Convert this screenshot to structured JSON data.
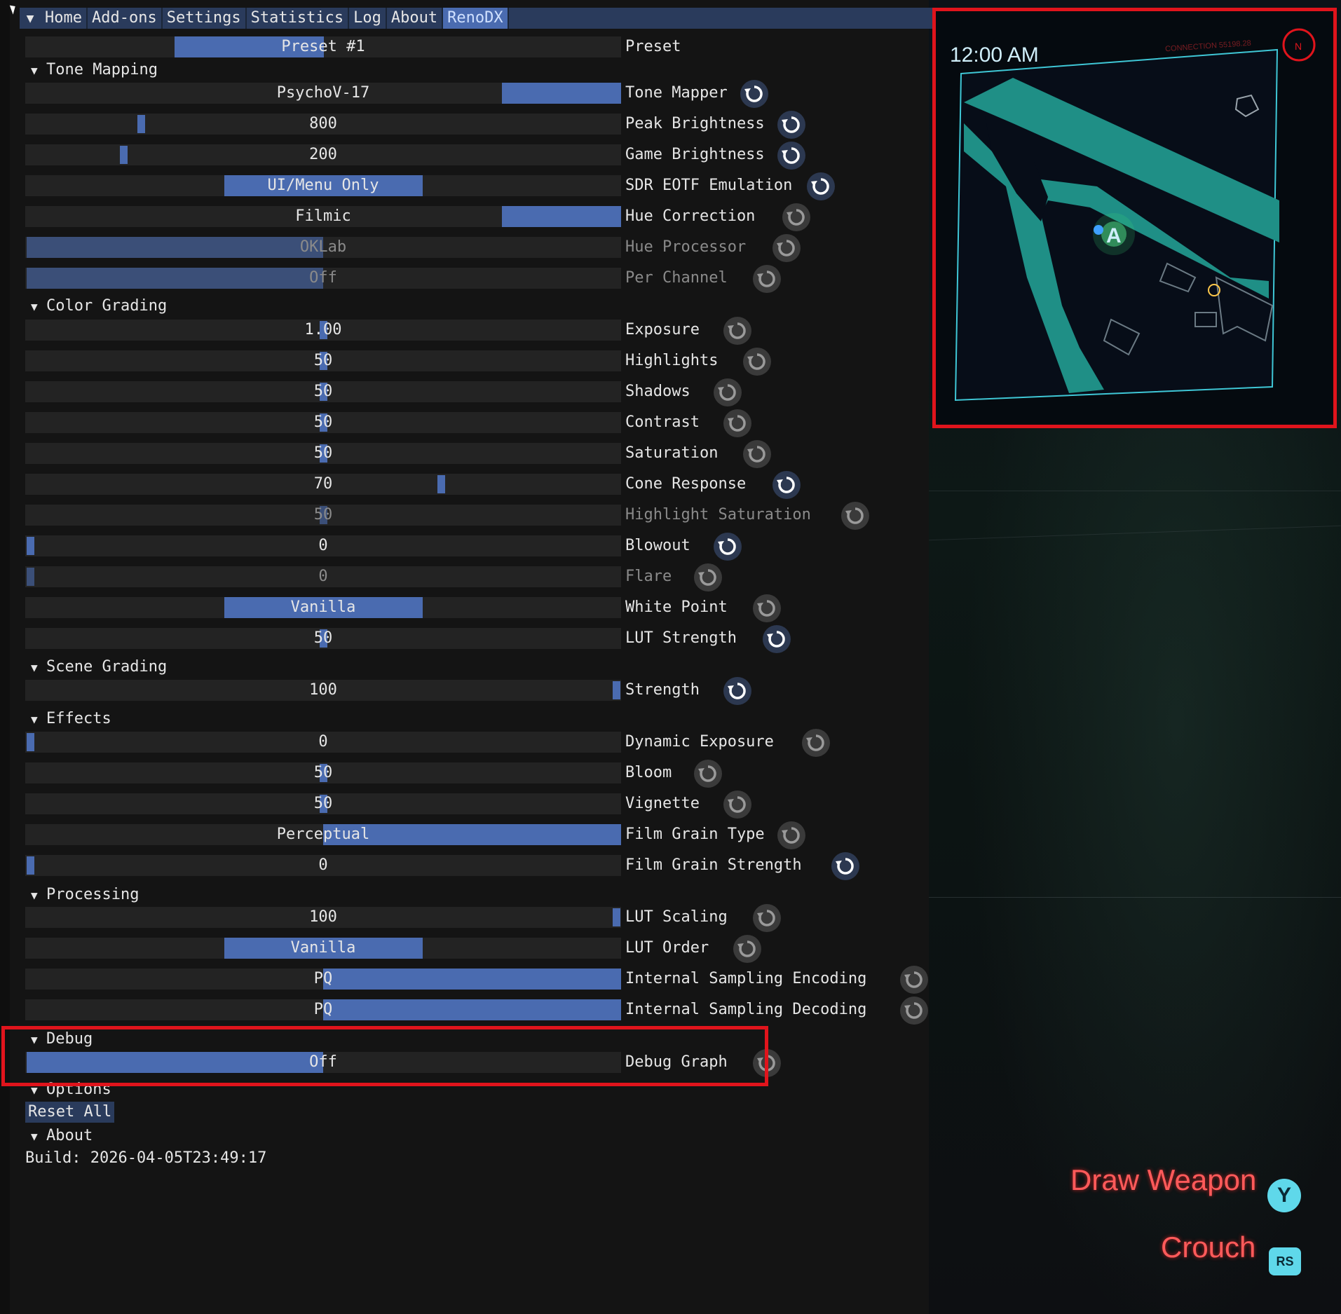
{
  "menu": {
    "items": [
      "Home",
      "Add-ons",
      "Settings",
      "Statistics",
      "Log",
      "About",
      "RenoDX"
    ],
    "active": "RenoDX"
  },
  "preset": {
    "value": "Preset #1",
    "label": "Preset"
  },
  "sections": {
    "tone_mapping": "Tone Mapping",
    "color_grading": "Color Grading",
    "scene_grading": "Scene Grading",
    "effects": "Effects",
    "processing": "Processing",
    "debug": "Debug",
    "options": "Options",
    "about": "About"
  },
  "settings": {
    "tone_mapper": {
      "value": "PsychoV-17",
      "label": "Tone Mapper"
    },
    "peak_brightness": {
      "value": "800",
      "label": "Peak Brightness"
    },
    "game_brightness": {
      "value": "200",
      "label": "Game Brightness"
    },
    "sdr_eotf": {
      "value": "UI/Menu Only",
      "label": "SDR EOTF Emulation"
    },
    "hue_correction": {
      "value": "Filmic",
      "label": "Hue Correction"
    },
    "hue_processor": {
      "value": "OKLab",
      "label": "Hue Processor"
    },
    "per_channel": {
      "value": "Off",
      "label": "Per Channel"
    },
    "exposure": {
      "value": "1.00",
      "label": "Exposure"
    },
    "highlights": {
      "value": "50",
      "label": "Highlights"
    },
    "shadows": {
      "value": "50",
      "label": "Shadows"
    },
    "contrast": {
      "value": "50",
      "label": "Contrast"
    },
    "saturation": {
      "value": "50",
      "label": "Saturation"
    },
    "cone_response": {
      "value": "70",
      "label": "Cone Response"
    },
    "highlight_saturation": {
      "value": "50",
      "label": "Highlight Saturation"
    },
    "blowout": {
      "value": "0",
      "label": "Blowout"
    },
    "flare": {
      "value": "0",
      "label": "Flare"
    },
    "white_point": {
      "value": "Vanilla",
      "label": "White Point"
    },
    "lut_strength": {
      "value": "50",
      "label": "LUT Strength"
    },
    "scene_strength": {
      "value": "100",
      "label": "Strength"
    },
    "dynamic_exposure": {
      "value": "0",
      "label": "Dynamic Exposure"
    },
    "bloom": {
      "value": "50",
      "label": "Bloom"
    },
    "vignette": {
      "value": "50",
      "label": "Vignette"
    },
    "film_grain_type": {
      "value": "Perceptual",
      "label": "Film Grain Type"
    },
    "film_grain_strength": {
      "value": "0",
      "label": "Film Grain Strength"
    },
    "lut_scaling": {
      "value": "100",
      "label": "LUT Scaling"
    },
    "lut_order": {
      "value": "Vanilla",
      "label": "LUT Order"
    },
    "sampling_encoding": {
      "value": "PQ",
      "label": "Internal Sampling Encoding"
    },
    "sampling_decoding": {
      "value": "PQ",
      "label": "Internal Sampling Decoding"
    },
    "debug_graph": {
      "value": "Off",
      "label": "Debug Graph"
    }
  },
  "options": {
    "reset_all": "Reset All"
  },
  "about": {
    "build": "Build: 2026-04-05T23:49:17"
  },
  "minimap": {
    "time": "12:00 AM",
    "connection": "CONNECTION 55198.28",
    "compass": "N"
  },
  "prompts": {
    "draw_weapon": {
      "label": "Draw Weapon",
      "button": "Y"
    },
    "crouch": {
      "label": "Crouch",
      "button": "RS"
    }
  },
  "colors": {
    "accent": "#4a6bb0",
    "frame": "#232323",
    "highlight_box": "#e0141c",
    "prompt": "#ff5a5a",
    "map_road": "#1f8f86"
  }
}
